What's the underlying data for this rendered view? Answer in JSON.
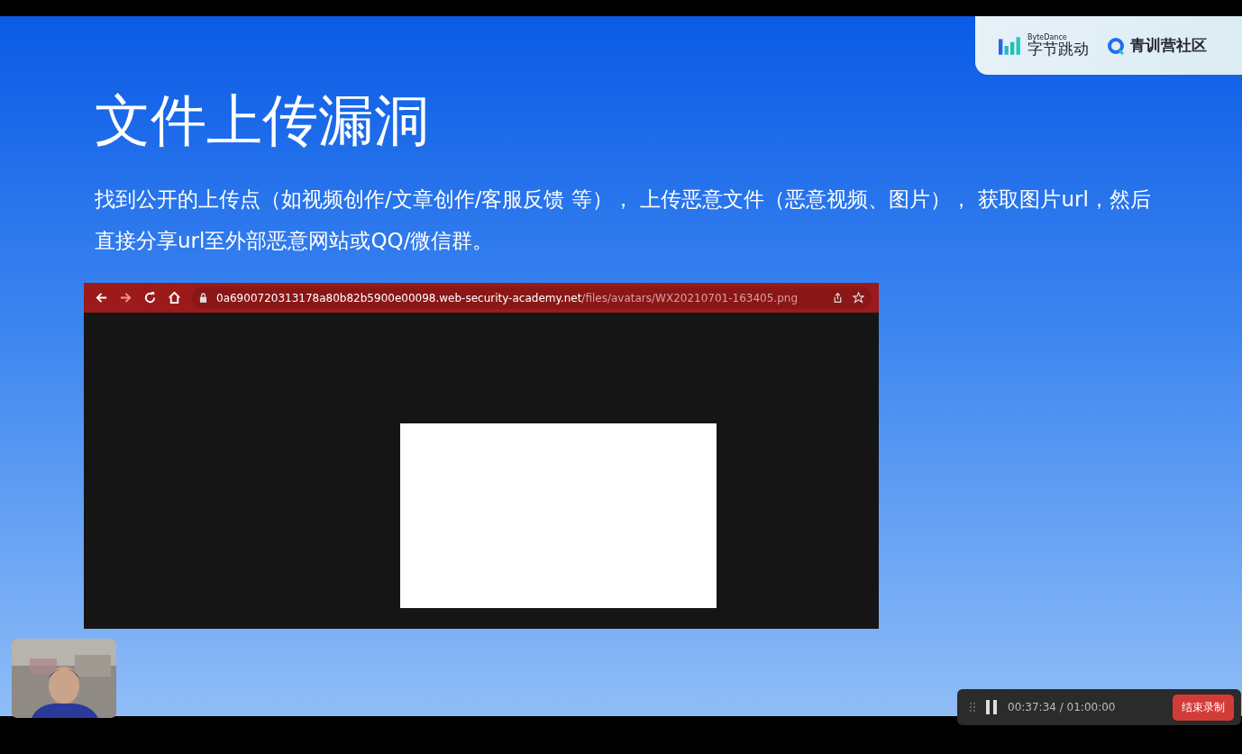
{
  "slide": {
    "title": "文件上传漏洞",
    "body": "找到公开的上传点（如视频创作/文章创作/客服反馈 等）， 上传恶意文件（恶意视频、图片）， 获取图片url，然后直接分享url至外部恶意网站或QQ/微信群。",
    "brand": {
      "company_small": "ByteDance",
      "company": "字节跳动",
      "community": "青训营社区"
    },
    "screenshot": {
      "url_host": "0a6900720313178a80b82b5900e00098.web-security-academy.net",
      "url_path": "/files/avatars/WX20210701-163405.png"
    }
  },
  "recorder": {
    "elapsed": "00:37:34",
    "separator": "/",
    "total": "01:00:00",
    "stop_button": "结束录制"
  }
}
